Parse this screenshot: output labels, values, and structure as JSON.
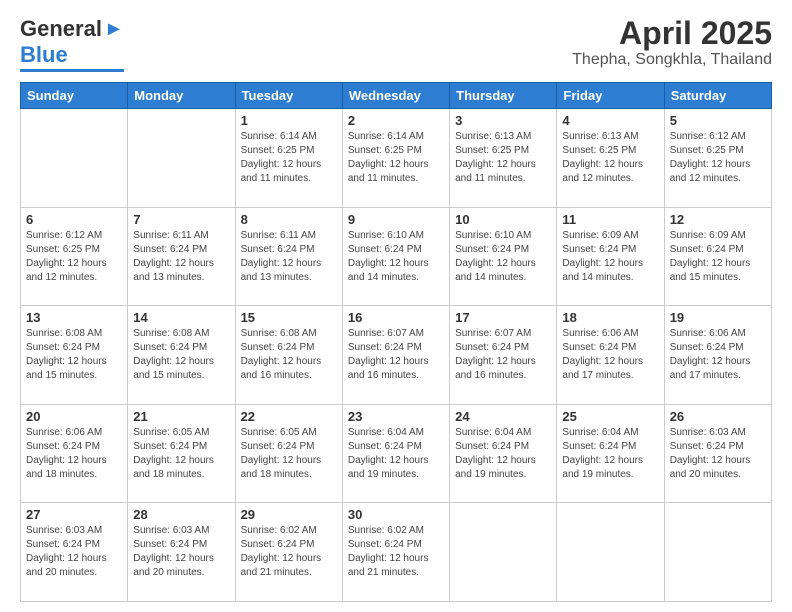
{
  "header": {
    "logo_general": "General",
    "logo_blue": "Blue",
    "title": "April 2025",
    "subtitle": "Thepha, Songkhla, Thailand"
  },
  "calendar": {
    "days_of_week": [
      "Sunday",
      "Monday",
      "Tuesday",
      "Wednesday",
      "Thursday",
      "Friday",
      "Saturday"
    ],
    "weeks": [
      [
        {
          "day": "",
          "info": ""
        },
        {
          "day": "",
          "info": ""
        },
        {
          "day": "1",
          "info": "Sunrise: 6:14 AM\nSunset: 6:25 PM\nDaylight: 12 hours and 11 minutes."
        },
        {
          "day": "2",
          "info": "Sunrise: 6:14 AM\nSunset: 6:25 PM\nDaylight: 12 hours and 11 minutes."
        },
        {
          "day": "3",
          "info": "Sunrise: 6:13 AM\nSunset: 6:25 PM\nDaylight: 12 hours and 11 minutes."
        },
        {
          "day": "4",
          "info": "Sunrise: 6:13 AM\nSunset: 6:25 PM\nDaylight: 12 hours and 12 minutes."
        },
        {
          "day": "5",
          "info": "Sunrise: 6:12 AM\nSunset: 6:25 PM\nDaylight: 12 hours and 12 minutes."
        }
      ],
      [
        {
          "day": "6",
          "info": "Sunrise: 6:12 AM\nSunset: 6:25 PM\nDaylight: 12 hours and 12 minutes."
        },
        {
          "day": "7",
          "info": "Sunrise: 6:11 AM\nSunset: 6:24 PM\nDaylight: 12 hours and 13 minutes."
        },
        {
          "day": "8",
          "info": "Sunrise: 6:11 AM\nSunset: 6:24 PM\nDaylight: 12 hours and 13 minutes."
        },
        {
          "day": "9",
          "info": "Sunrise: 6:10 AM\nSunset: 6:24 PM\nDaylight: 12 hours and 14 minutes."
        },
        {
          "day": "10",
          "info": "Sunrise: 6:10 AM\nSunset: 6:24 PM\nDaylight: 12 hours and 14 minutes."
        },
        {
          "day": "11",
          "info": "Sunrise: 6:09 AM\nSunset: 6:24 PM\nDaylight: 12 hours and 14 minutes."
        },
        {
          "day": "12",
          "info": "Sunrise: 6:09 AM\nSunset: 6:24 PM\nDaylight: 12 hours and 15 minutes."
        }
      ],
      [
        {
          "day": "13",
          "info": "Sunrise: 6:08 AM\nSunset: 6:24 PM\nDaylight: 12 hours and 15 minutes."
        },
        {
          "day": "14",
          "info": "Sunrise: 6:08 AM\nSunset: 6:24 PM\nDaylight: 12 hours and 15 minutes."
        },
        {
          "day": "15",
          "info": "Sunrise: 6:08 AM\nSunset: 6:24 PM\nDaylight: 12 hours and 16 minutes."
        },
        {
          "day": "16",
          "info": "Sunrise: 6:07 AM\nSunset: 6:24 PM\nDaylight: 12 hours and 16 minutes."
        },
        {
          "day": "17",
          "info": "Sunrise: 6:07 AM\nSunset: 6:24 PM\nDaylight: 12 hours and 16 minutes."
        },
        {
          "day": "18",
          "info": "Sunrise: 6:06 AM\nSunset: 6:24 PM\nDaylight: 12 hours and 17 minutes."
        },
        {
          "day": "19",
          "info": "Sunrise: 6:06 AM\nSunset: 6:24 PM\nDaylight: 12 hours and 17 minutes."
        }
      ],
      [
        {
          "day": "20",
          "info": "Sunrise: 6:06 AM\nSunset: 6:24 PM\nDaylight: 12 hours and 18 minutes."
        },
        {
          "day": "21",
          "info": "Sunrise: 6:05 AM\nSunset: 6:24 PM\nDaylight: 12 hours and 18 minutes."
        },
        {
          "day": "22",
          "info": "Sunrise: 6:05 AM\nSunset: 6:24 PM\nDaylight: 12 hours and 18 minutes."
        },
        {
          "day": "23",
          "info": "Sunrise: 6:04 AM\nSunset: 6:24 PM\nDaylight: 12 hours and 19 minutes."
        },
        {
          "day": "24",
          "info": "Sunrise: 6:04 AM\nSunset: 6:24 PM\nDaylight: 12 hours and 19 minutes."
        },
        {
          "day": "25",
          "info": "Sunrise: 6:04 AM\nSunset: 6:24 PM\nDaylight: 12 hours and 19 minutes."
        },
        {
          "day": "26",
          "info": "Sunrise: 6:03 AM\nSunset: 6:24 PM\nDaylight: 12 hours and 20 minutes."
        }
      ],
      [
        {
          "day": "27",
          "info": "Sunrise: 6:03 AM\nSunset: 6:24 PM\nDaylight: 12 hours and 20 minutes."
        },
        {
          "day": "28",
          "info": "Sunrise: 6:03 AM\nSunset: 6:24 PM\nDaylight: 12 hours and 20 minutes."
        },
        {
          "day": "29",
          "info": "Sunrise: 6:02 AM\nSunset: 6:24 PM\nDaylight: 12 hours and 21 minutes."
        },
        {
          "day": "30",
          "info": "Sunrise: 6:02 AM\nSunset: 6:24 PM\nDaylight: 12 hours and 21 minutes."
        },
        {
          "day": "",
          "info": ""
        },
        {
          "day": "",
          "info": ""
        },
        {
          "day": "",
          "info": ""
        }
      ]
    ]
  }
}
